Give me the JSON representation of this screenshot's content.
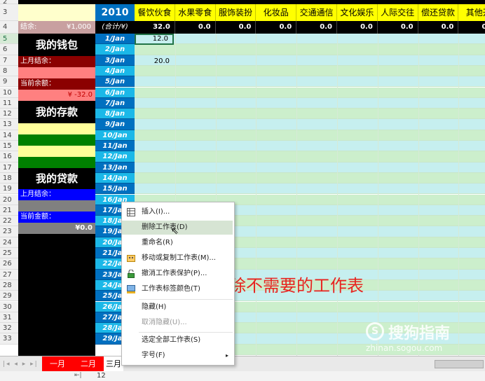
{
  "header": {
    "year": "2010",
    "sum_label": "(合计/¥)"
  },
  "categories": [
    "餐饮伙食",
    "水果零食",
    "服饰装扮",
    "化妆品",
    "交通通信",
    "文化娱乐",
    "人际交往",
    "偿还贷款",
    "其他开"
  ],
  "totals": [
    "32.0",
    "0.0",
    "0.0",
    "0.0",
    "0.0",
    "0.0",
    "0.0",
    "0.0",
    "0.0"
  ],
  "row_numbers": [
    "2",
    "3",
    "4",
    "5",
    "6",
    "7",
    "8",
    "9",
    "10",
    "11",
    "12",
    "13",
    "14",
    "15",
    "16",
    "17",
    "18",
    "19",
    "20",
    "21",
    "22",
    "23",
    "24",
    "25",
    "26",
    "27",
    "28",
    "29",
    "30",
    "31",
    "32",
    "33"
  ],
  "left_panel": {
    "balance_label": "结余:",
    "balance_value": "¥1,000",
    "wallet_title": "我的钱包",
    "last_month_label": "上月结余：",
    "current_balance_label": "当前余额：",
    "current_balance_value": "¥ -32.0",
    "savings_title": "我的存款",
    "loan_title": "我的贷款",
    "loan_last_month_label": "上月结余：",
    "loan_current_label": "当前金额：",
    "loan_current_value": "¥0.0"
  },
  "dates": [
    "1/Jan",
    "2/Jan",
    "3/Jan",
    "4/Jan",
    "5/Jan",
    "6/Jan",
    "7/Jan",
    "8/Jan",
    "9/Jan",
    "10/Jan",
    "11/Jan",
    "12/Jan",
    "13/Jan",
    "14/Jan",
    "15/Jan",
    "16/Jan",
    "17/Jan",
    "18/Jan",
    "19/Jan",
    "20/Jan",
    "21/Jan",
    "22/Jan",
    "23/Jan",
    "24/Jan",
    "25/Jan",
    "26/Jan",
    "27/Jan",
    "28/Jan",
    "29/Jan"
  ],
  "values": {
    "jan1": "12.0",
    "jan3": "20.0"
  },
  "context_menu": {
    "items": [
      {
        "label": "插入(I)...",
        "icon": "insert-table-icon"
      },
      {
        "label": "删除工作表(D)",
        "icon": ""
      },
      {
        "label": "重命名(R)",
        "icon": ""
      },
      {
        "label": "移动或复制工作表(M)...",
        "icon": "move-copy-icon"
      },
      {
        "label": "撤消工作表保护(P)...",
        "icon": "unprotect-icon"
      },
      {
        "label": "工作表标签颜色(T)",
        "icon": "tab-color-icon"
      },
      {
        "label": "隐藏(H)",
        "icon": ""
      },
      {
        "label": "取消隐藏(U)...",
        "icon": ""
      },
      {
        "label": "选定全部工作表(S)",
        "icon": ""
      },
      {
        "label": "字号(F)",
        "icon": "submenu-arrow-icon"
      }
    ]
  },
  "annotation": "删除不需要的工作表",
  "watermark": {
    "brand": "搜狗指南",
    "url": "zhinan.sogou.com"
  },
  "sheet_tabs": [
    "一月",
    "二月",
    "三月"
  ],
  "status": {
    "value": "12"
  },
  "colors": {
    "accent_red": "#e8231f",
    "tab_red": "#ff0000",
    "grid_green": "#ccefcc",
    "grid_cyan": "#c6efef",
    "date_blue": "#0070c0",
    "date_cyan": "#1bb8e8",
    "category_yellow": "#ffff00"
  }
}
